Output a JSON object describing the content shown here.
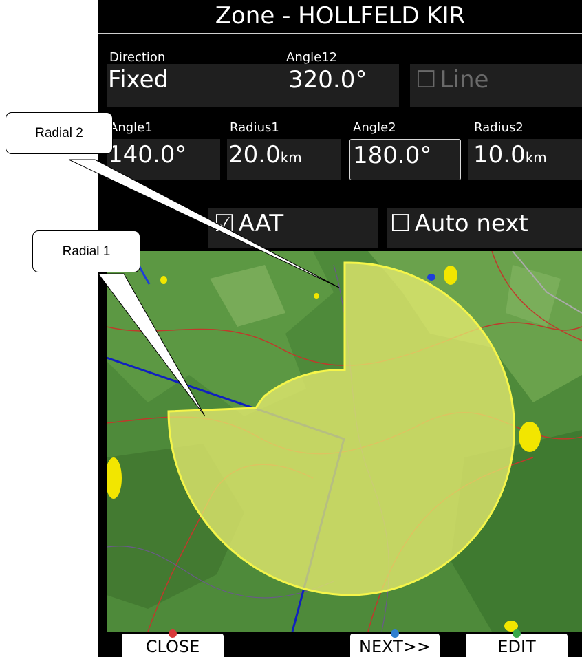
{
  "title": "Zone - HOLLFELD KIR",
  "fields": {
    "direction": {
      "label": "Direction",
      "value": "Fixed"
    },
    "angle12": {
      "label": "Angle12",
      "value": "320.0°"
    },
    "line": {
      "label": "Line",
      "checked": false
    },
    "angle1": {
      "label": "Angle1",
      "value": "140.0°"
    },
    "radius1": {
      "label": "Radius1",
      "value": "20.0",
      "unit": "km"
    },
    "angle2": {
      "label": "Angle2",
      "value": "180.0°"
    },
    "radius2": {
      "label": "Radius2",
      "value": "10.0",
      "unit": "km"
    }
  },
  "checkboxes": {
    "aat": {
      "label": "AAT",
      "glyph": "☑",
      "checked": true
    },
    "auto_next": {
      "label": "Auto next",
      "glyph": "☐",
      "checked": false
    }
  },
  "softkeys": [
    {
      "label": "CLOSE",
      "indicator_color": "#d93a3a"
    },
    {
      "label": "NEXT>>",
      "indicator_color": "#2f7fd0"
    },
    {
      "label": "EDIT",
      "indicator_color": "#3aa84a"
    }
  ],
  "callouts": {
    "radial2": "Radial 2",
    "radial1": "Radial 1"
  },
  "map": {
    "zone_fill": "#e6ea70",
    "zone_outline": "#f5f54a",
    "airspace_line": "#1020c0",
    "road_color": "#c0392b",
    "terrain_base": "#4e8a3a"
  }
}
